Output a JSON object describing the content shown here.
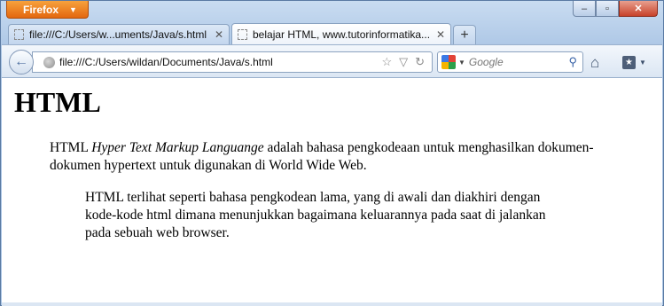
{
  "app": {
    "menu_button": "Firefox",
    "window_controls": {
      "minimize": "–",
      "maximize": "▫",
      "close": "✕"
    }
  },
  "tabs": [
    {
      "label": "file:///C:/Users/w...uments/Java/s.html",
      "active": false
    },
    {
      "label": "belajar HTML, www.tutorinformatika....",
      "active": true
    }
  ],
  "new_tab_label": "+",
  "nav": {
    "url": "file:///C:/Users/wildan/Documents/Java/s.html",
    "search_placeholder": "Google"
  },
  "page": {
    "heading": "HTML",
    "p1_lead": "HTML ",
    "p1_italic": "Hyper Text Markup Languange",
    "p1_rest": " adalah bahasa pengkodeaan untuk menghasilkan dokumen-dokumen hypertext untuk digunakan di World Wide Web.",
    "p2": "HTML terlihat seperti bahasa pengkodean lama, yang di awali dan diakhiri dengan kode-kode html dimana menunjukkan bagaimana keluarannya pada saat di jalankan pada sebuah web browser."
  },
  "icons": [
    "firefox-menu-icon",
    "minimize-icon",
    "maximize-icon",
    "close-icon",
    "page-icon",
    "tab-close-icon",
    "back-arrow-icon",
    "globe-icon",
    "bookmark-star-icon",
    "history-dropdown-icon",
    "reload-icon",
    "google-icon",
    "search-icon",
    "home-icon",
    "bookmarks-menu-icon"
  ],
  "colors": {
    "firefox_orange": "#e3670f",
    "chrome_blue": "#c9dcf1",
    "close_red": "#c7422a"
  }
}
